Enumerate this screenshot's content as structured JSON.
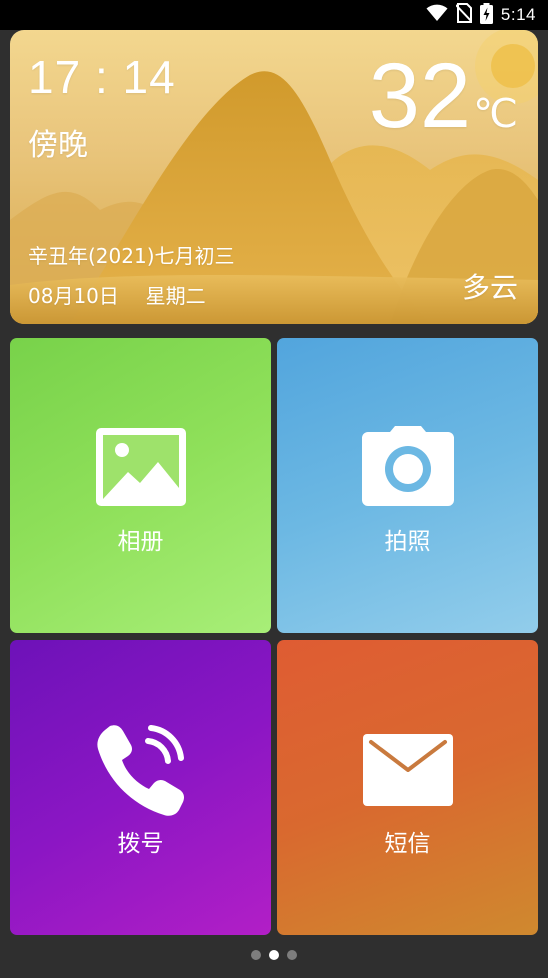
{
  "status_bar": {
    "time": "5:14",
    "icons": [
      "wifi-icon",
      "no-sim-icon",
      "battery-charging-icon"
    ]
  },
  "weather": {
    "time": "17 : 14",
    "period": "傍晚",
    "temperature": "32",
    "unit": "℃",
    "lunar_date": "辛丑年(2021)七月初三",
    "date": "08月10日",
    "weekday": "星期二",
    "condition": "多云"
  },
  "apps": [
    {
      "label": "相册",
      "icon": "image-icon",
      "color": "#8fe05a"
    },
    {
      "label": "拍照",
      "icon": "camera-icon",
      "color": "#6cb8e3"
    },
    {
      "label": "拨号",
      "icon": "phone-icon",
      "color": "#8b16c4"
    },
    {
      "label": "短信",
      "icon": "mail-icon",
      "color": "#d9692f"
    }
  ],
  "pager": {
    "pages": 3,
    "active": 2
  }
}
